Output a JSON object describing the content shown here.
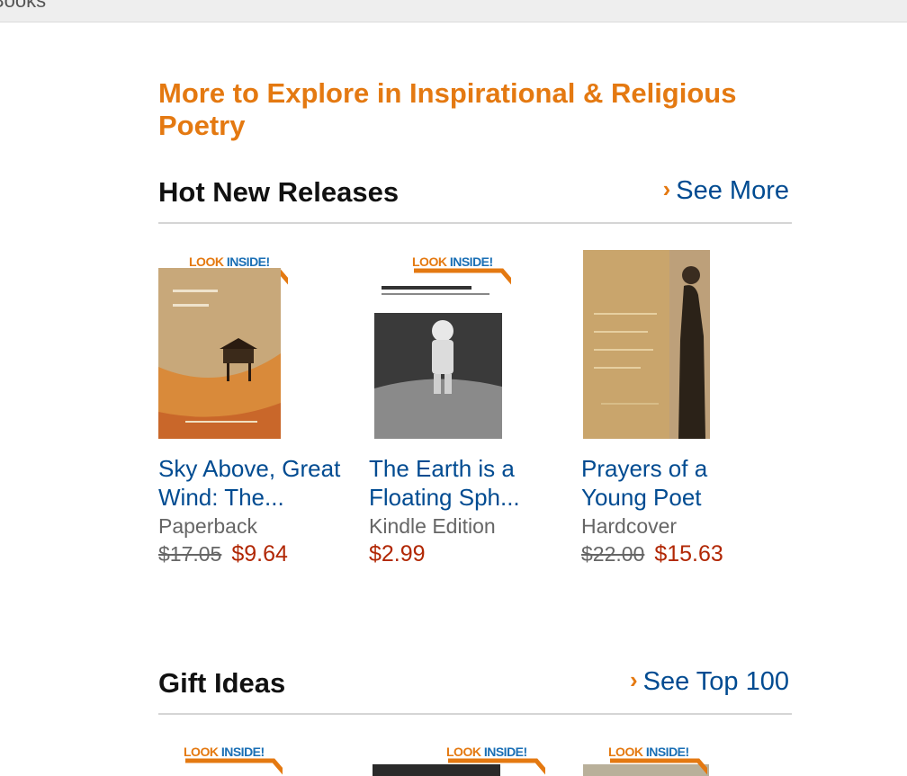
{
  "topbar": {
    "text": "Books"
  },
  "heading": "More to Explore in Inspirational & Religious Poetry",
  "sections": [
    {
      "title": "Hot New Releases",
      "link": "See More",
      "products": [
        {
          "title": "Sky Above, Great Wind: The...",
          "format": "Paperback",
          "list_price": "$17.05",
          "price": "$9.64",
          "badge": true
        },
        {
          "title": "The Earth is a Floating Sph...",
          "format": "Kindle Edition",
          "list_price": "",
          "price": "$2.99",
          "badge": true
        },
        {
          "title": "Prayers of a Young Poet",
          "format": "Hardcover",
          "list_price": "$22.00",
          "price": "$15.63",
          "badge": false
        }
      ]
    },
    {
      "title": "Gift Ideas",
      "link": "See Top 100"
    }
  ],
  "badge": {
    "look": "LOOK",
    "inside": "INSIDE!"
  },
  "colors": {
    "accent": "#e47911",
    "link": "#004b91",
    "price": "#b12704"
  }
}
